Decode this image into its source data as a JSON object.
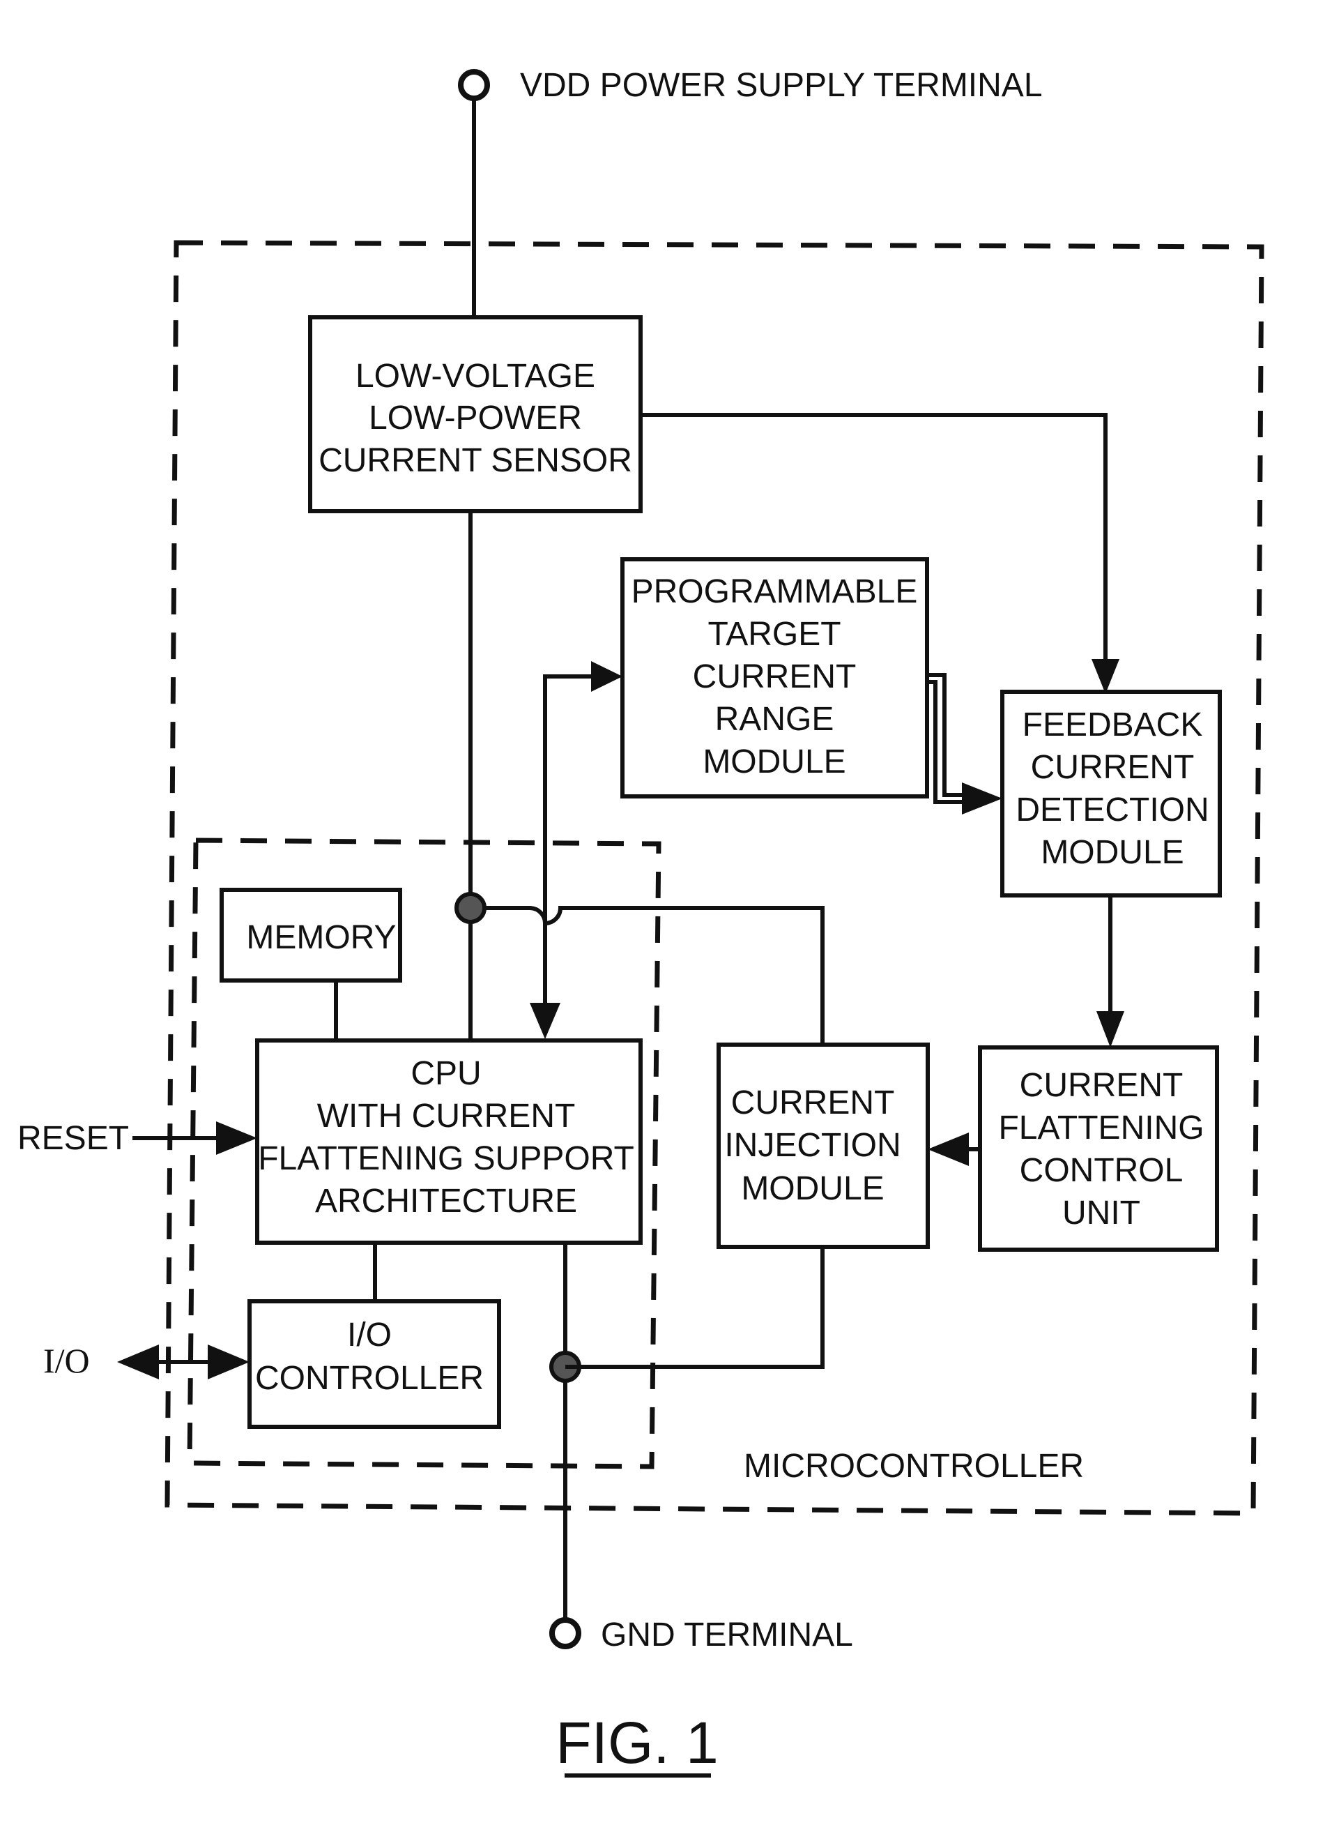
{
  "figure": {
    "caption": "FIG. 1",
    "terminals": {
      "vdd": "VDD POWER SUPPLY TERMINAL",
      "gnd": "GND TERMINAL"
    },
    "external_signals": {
      "reset": "RESET",
      "io": "I/O"
    },
    "regions": {
      "microcontroller": "MICROCONTROLLER"
    },
    "blocks": {
      "current_sensor": [
        "LOW-VOLTAGE",
        "LOW-POWER",
        "CURRENT SENSOR"
      ],
      "target_range": [
        "PROGRAMMABLE",
        "TARGET",
        "CURRENT",
        "RANGE",
        "MODULE"
      ],
      "feedback_detection": [
        "FEEDBACK",
        "CURRENT",
        "DETECTION",
        "MODULE"
      ],
      "memory": [
        "MEMORY"
      ],
      "cpu": [
        "CPU",
        "WITH CURRENT",
        "FLATTENING SUPPORT",
        "ARCHITECTURE"
      ],
      "current_injection": [
        "CURRENT",
        "INJECTION",
        "MODULE"
      ],
      "flattening_control": [
        "CURRENT",
        "FLATTENING",
        "CONTROL",
        "UNIT"
      ],
      "io_controller": [
        "I/O",
        "CONTROLLER"
      ]
    }
  }
}
